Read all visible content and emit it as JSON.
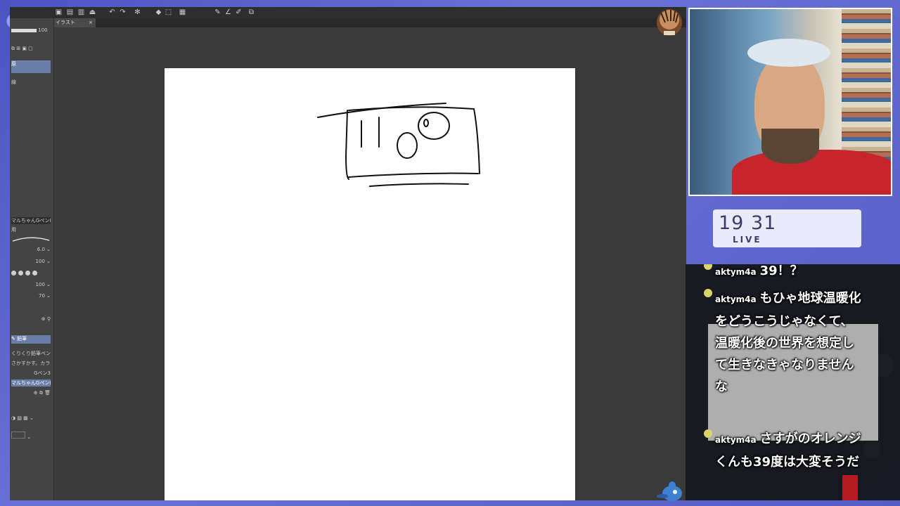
{
  "app": {
    "tab_label": "イラスト",
    "tab_close": "×",
    "toolbar_icons": [
      "new-icon",
      "open-icon",
      "save-icon",
      "upload-icon",
      "undo-icon",
      "redo-icon",
      "settings-icon",
      "fill-icon",
      "select-icon",
      "ruler-icon",
      "pen-icon",
      "line-icon",
      "edit-icon"
    ],
    "left_panel": {
      "opacity_value": "100",
      "layer_label_1": "原",
      "layer_label_2": "線",
      "brush_name": "マルちゃんGペン(BFい用)",
      "brush_sub": "用",
      "size_value": "6.0",
      "opacity2": "100",
      "density": "100",
      "value_70": "70",
      "subtool_header": "鉛筆",
      "subtool_items": [
        "くりくり鉛筆ペン",
        "さかすかす。カラー",
        "Gペン3",
        "マルちゃんGペン(BFい用)"
      ]
    }
  },
  "stream": {
    "clock_time": "19 31",
    "live_label": "LIVE"
  },
  "chat": {
    "messages": [
      {
        "user": "aktym4a",
        "text": "39！？"
      },
      {
        "user": "aktym4a",
        "text": "もひゃ地球温暖化をどうこうじゃなくて、温暖化後の世界を想定して生きなきゃなりませんな"
      },
      {
        "user": "aktym4a",
        "text": "さすがのオレンジくんも39度は大変そうだ"
      }
    ]
  },
  "colors": {
    "frame_bg": "#5a63c8",
    "app_bg": "#3b3b3b",
    "paper": "#ffffff",
    "shirt_red": "#c8242b",
    "clock_bg": "#e9ebfb"
  }
}
